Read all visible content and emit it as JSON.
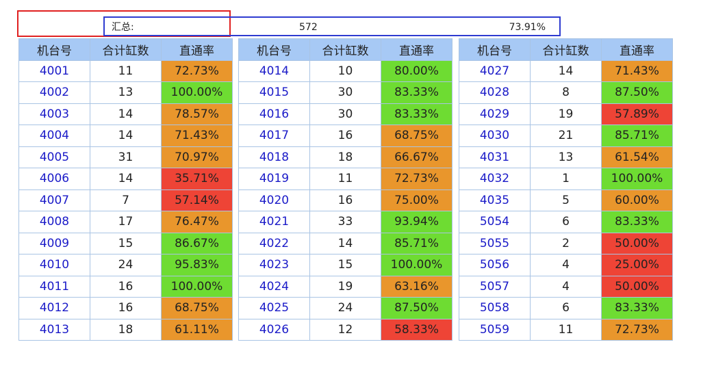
{
  "summary": {
    "label": "汇总:",
    "total_count": "572",
    "total_rate": "73.91%"
  },
  "headers": {
    "machine": "机台号",
    "count": "合计缸数",
    "rate": "直通率"
  },
  "colors": {
    "green": "#6edc32",
    "orange": "#e9962c",
    "red": "#ee4436",
    "header_bg": "#a7c9f5",
    "machine_text": "#1a1ac8",
    "outer_box": "#e02020",
    "inner_box": "#2e3bd0"
  },
  "tables": [
    {
      "rows": [
        {
          "machine": "4001",
          "count": "11",
          "rate": "72.73%",
          "status": "orange"
        },
        {
          "machine": "4002",
          "count": "13",
          "rate": "100.00%",
          "status": "green"
        },
        {
          "machine": "4003",
          "count": "14",
          "rate": "78.57%",
          "status": "orange"
        },
        {
          "machine": "4004",
          "count": "14",
          "rate": "71.43%",
          "status": "orange"
        },
        {
          "machine": "4005",
          "count": "31",
          "rate": "70.97%",
          "status": "orange"
        },
        {
          "machine": "4006",
          "count": "14",
          "rate": "35.71%",
          "status": "red"
        },
        {
          "machine": "4007",
          "count": "7",
          "rate": "57.14%",
          "status": "red"
        },
        {
          "machine": "4008",
          "count": "17",
          "rate": "76.47%",
          "status": "orange"
        },
        {
          "machine": "4009",
          "count": "15",
          "rate": "86.67%",
          "status": "green"
        },
        {
          "machine": "4010",
          "count": "24",
          "rate": "95.83%",
          "status": "green"
        },
        {
          "machine": "4011",
          "count": "16",
          "rate": "100.00%",
          "status": "green"
        },
        {
          "machine": "4012",
          "count": "16",
          "rate": "68.75%",
          "status": "orange"
        },
        {
          "machine": "4013",
          "count": "18",
          "rate": "61.11%",
          "status": "orange"
        }
      ]
    },
    {
      "rows": [
        {
          "machine": "4014",
          "count": "10",
          "rate": "80.00%",
          "status": "green"
        },
        {
          "machine": "4015",
          "count": "30",
          "rate": "83.33%",
          "status": "green"
        },
        {
          "machine": "4016",
          "count": "30",
          "rate": "83.33%",
          "status": "green"
        },
        {
          "machine": "4017",
          "count": "16",
          "rate": "68.75%",
          "status": "orange"
        },
        {
          "machine": "4018",
          "count": "18",
          "rate": "66.67%",
          "status": "orange"
        },
        {
          "machine": "4019",
          "count": "11",
          "rate": "72.73%",
          "status": "orange"
        },
        {
          "machine": "4020",
          "count": "16",
          "rate": "75.00%",
          "status": "orange"
        },
        {
          "machine": "4021",
          "count": "33",
          "rate": "93.94%",
          "status": "green"
        },
        {
          "machine": "4022",
          "count": "14",
          "rate": "85.71%",
          "status": "green"
        },
        {
          "machine": "4023",
          "count": "15",
          "rate": "100.00%",
          "status": "green"
        },
        {
          "machine": "4024",
          "count": "19",
          "rate": "63.16%",
          "status": "orange"
        },
        {
          "machine": "4025",
          "count": "24",
          "rate": "87.50%",
          "status": "green"
        },
        {
          "machine": "4026",
          "count": "12",
          "rate": "58.33%",
          "status": "red"
        }
      ]
    },
    {
      "rows": [
        {
          "machine": "4027",
          "count": "14",
          "rate": "71.43%",
          "status": "orange"
        },
        {
          "machine": "4028",
          "count": "8",
          "rate": "87.50%",
          "status": "green"
        },
        {
          "machine": "4029",
          "count": "19",
          "rate": "57.89%",
          "status": "red"
        },
        {
          "machine": "4030",
          "count": "21",
          "rate": "85.71%",
          "status": "green"
        },
        {
          "machine": "4031",
          "count": "13",
          "rate": "61.54%",
          "status": "orange"
        },
        {
          "machine": "4032",
          "count": "1",
          "rate": "100.00%",
          "status": "green"
        },
        {
          "machine": "4035",
          "count": "5",
          "rate": "60.00%",
          "status": "orange"
        },
        {
          "machine": "5054",
          "count": "6",
          "rate": "83.33%",
          "status": "green"
        },
        {
          "machine": "5055",
          "count": "2",
          "rate": "50.00%",
          "status": "red"
        },
        {
          "machine": "5056",
          "count": "4",
          "rate": "25.00%",
          "status": "red"
        },
        {
          "machine": "5057",
          "count": "4",
          "rate": "50.00%",
          "status": "red"
        },
        {
          "machine": "5058",
          "count": "6",
          "rate": "83.33%",
          "status": "green"
        },
        {
          "machine": "5059",
          "count": "11",
          "rate": "72.73%",
          "status": "orange"
        }
      ]
    }
  ]
}
